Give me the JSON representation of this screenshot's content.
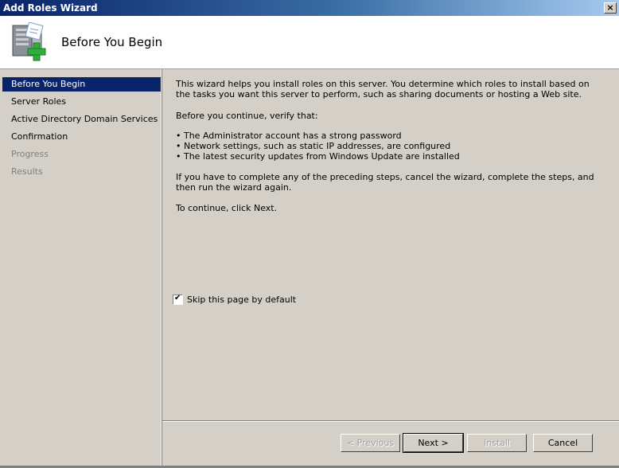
{
  "window": {
    "title": "Add Roles Wizard",
    "close_label": "×"
  },
  "header": {
    "title": "Before You Begin"
  },
  "nav": {
    "items": [
      {
        "label": "Before You Begin",
        "state": "active"
      },
      {
        "label": "Server Roles",
        "state": "enabled"
      },
      {
        "label": "Active Directory Domain Services",
        "state": "enabled"
      },
      {
        "label": "Confirmation",
        "state": "enabled"
      },
      {
        "label": "Progress",
        "state": "disabled"
      },
      {
        "label": "Results",
        "state": "disabled"
      }
    ]
  },
  "content": {
    "intro": "This wizard helps you install roles on this server. You determine which roles to install based on the tasks you want this server to perform, such as sharing documents or hosting a Web site.",
    "verify_heading": "Before you continue, verify that:",
    "bullets": [
      "• The Administrator account has a strong password",
      "• Network settings, such as static IP addresses, are configured",
      "• The latest security updates from Windows Update are installed"
    ],
    "preceding_steps": "If you have to complete any of the preceding steps, cancel the wizard, complete the steps, and then run the wizard again.",
    "continue_text": "To continue, click Next."
  },
  "skip_checkbox": {
    "label": "Skip this page by default",
    "checked": true,
    "mark": "✔"
  },
  "buttons": {
    "previous": "< Previous",
    "next": "Next >",
    "install": "Install",
    "cancel": "Cancel"
  },
  "colors": {
    "selection": "#0a246a",
    "dialog_face": "#d4d0c8"
  }
}
